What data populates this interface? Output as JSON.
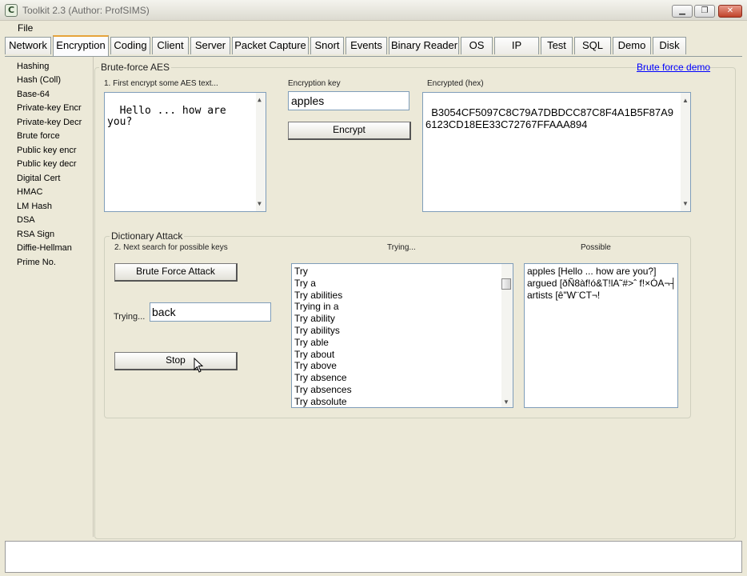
{
  "window": {
    "title": "Toolkit 2.3 (Author: ProfSIMS)",
    "app_icon": "C",
    "controls": [
      "minimize",
      "maximize",
      "close"
    ]
  },
  "menu": {
    "file": "File"
  },
  "tabs": [
    "Network",
    "Encryption",
    "Coding",
    "Client",
    "Server",
    "Packet Capture",
    "Snort",
    "Events",
    "Binary Reader",
    "OS",
    "IP",
    "Test",
    "SQL",
    "Demo",
    "Disk"
  ],
  "active_tab": "Encryption",
  "sidebar": [
    "Hashing",
    "Hash (Coll)",
    "Base-64",
    "Private-key Encr",
    "Private-key Decr",
    "Brute force",
    "Public key encr",
    "Public key decr",
    "Digital Cert",
    "HMAC",
    "LM Hash",
    "DSA",
    "RSA Sign",
    "Diffie-Hellman",
    "Prime No."
  ],
  "bruteforce": {
    "group_title": "Brute-force AES",
    "demo_link": "Brute force demo",
    "step1_label": "1. First encrypt some AES text...",
    "plaintext": "Hello ... how are\nyou?",
    "key_label": "Encryption key",
    "key_value": "apples",
    "encrypt_button": "Encrypt",
    "cipher_label": "Encrypted (hex)",
    "cipher_value": "B3054CF5097C8C79A7DBDCC87C8F4A1B5F87A96123CD18EE33C72767FFAAA894"
  },
  "dictionary": {
    "group_title": "Dictionary Attack",
    "step2_label": "2. Next search for possible keys",
    "attack_button": "Brute Force Attack",
    "trying_label": "Trying...",
    "trying_value": "back",
    "stop_button": "Stop",
    "trying_header": "Trying...",
    "possible_header": "Possible",
    "trying_list": [
      "Try",
      "Try a",
      "Try abilities",
      "Trying in a",
      "Try ability",
      "Try abilitys",
      "Try able",
      "Try about",
      "Try above",
      "Try absence",
      "Try absences",
      "Try absolute"
    ],
    "possible_text": "apples [Hello ... how are you?]\nargued [ðÑ8àf!ó&T!lA˜#>ˆ f!×ÓA¬┤\nartists [ê\"W¨CT¬!"
  },
  "status": ""
}
